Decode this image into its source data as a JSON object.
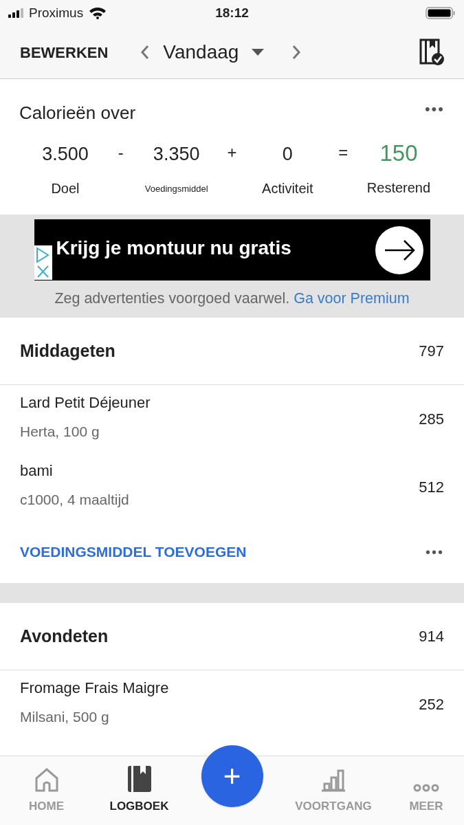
{
  "status_bar": {
    "carrier": "Proximus",
    "time": "18:12"
  },
  "nav": {
    "edit": "BEWERKEN",
    "date": "Vandaag"
  },
  "calories": {
    "title": "Calorieën over",
    "more": "•••",
    "terms": [
      {
        "value": "3.500",
        "label": "Doel",
        "kind": "term"
      },
      {
        "op": "-"
      },
      {
        "value": "3.350",
        "label": "Voedingsmiddel",
        "kind": "small"
      },
      {
        "op": "+"
      },
      {
        "value": "0",
        "label": "Activiteit",
        "kind": "term"
      },
      {
        "op": "="
      },
      {
        "value": "150",
        "label": "Resterend",
        "kind": "result"
      }
    ]
  },
  "ad": {
    "headline": "Krijg je montuur nu gratis",
    "note": "Zeg advertenties voorgoed vaarwel.",
    "link": "Ga voor Premium"
  },
  "meals": [
    {
      "name": "Middageten",
      "total": "797",
      "items": [
        {
          "name": "Lard Petit Déjeuner",
          "detail": "Herta, 100 g",
          "calories": "285"
        },
        {
          "name": "bami",
          "detail": "c1000, 4 maaltijd",
          "calories": "512"
        }
      ],
      "add": "VOEDINGSMIDDEL TOEVOEGEN",
      "more": "•••"
    },
    {
      "name": "Avondeten",
      "total": "914",
      "items": [
        {
          "name": "Fromage Frais Maigre",
          "detail": "Milsani, 500 g",
          "calories": "252"
        }
      ]
    }
  ],
  "tabs": [
    {
      "label": "HOME",
      "selected": false
    },
    {
      "label": "LOGBOEK",
      "selected": true
    },
    {
      "kind": "add",
      "label": "+"
    },
    {
      "label": "VOORTGANG",
      "selected": false
    },
    {
      "label": "MEER",
      "selected": false
    }
  ]
}
